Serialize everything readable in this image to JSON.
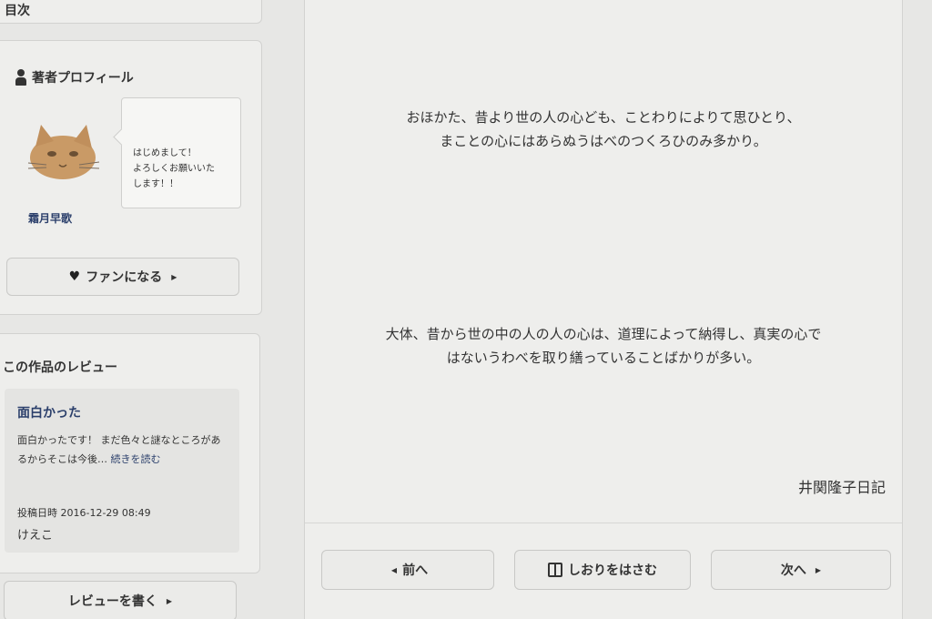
{
  "sidebar": {
    "toc_title": "目次",
    "profile": {
      "heading": "著者プロフィール",
      "speech": [
        "はじめまして！",
        "よろしくお願いいた",
        "します！！"
      ],
      "author_name": "霜月早歌",
      "fan_button": "ファンになる"
    },
    "review": {
      "heading": "この作品のレビュー",
      "title": "面白かった",
      "body": "面白かったです！ まだ色々と謎なところがあるからそこは今後…",
      "read_more": "続きを読む",
      "date_label": "投稿日時 2016-12-29 08:49",
      "user": "けえこ",
      "write_button": "レビューを書く"
    }
  },
  "reader": {
    "original_lines": [
      "おほかた、昔より世の人の心ども、ことわりによりて思ひとり、",
      "まことの心にはあらぬうはべのつくろひのみ多かり。"
    ],
    "translation_lines": [
      "大体、昔から世の中の人の人の心は、道理によって納得し、真実の心で",
      "はないうわべを取り繕っていることばかりが多い。"
    ],
    "source": "井関隆子日記"
  },
  "nav": {
    "prev": "前へ",
    "bookmark": "しおりをはさむ",
    "next": "次へ"
  }
}
